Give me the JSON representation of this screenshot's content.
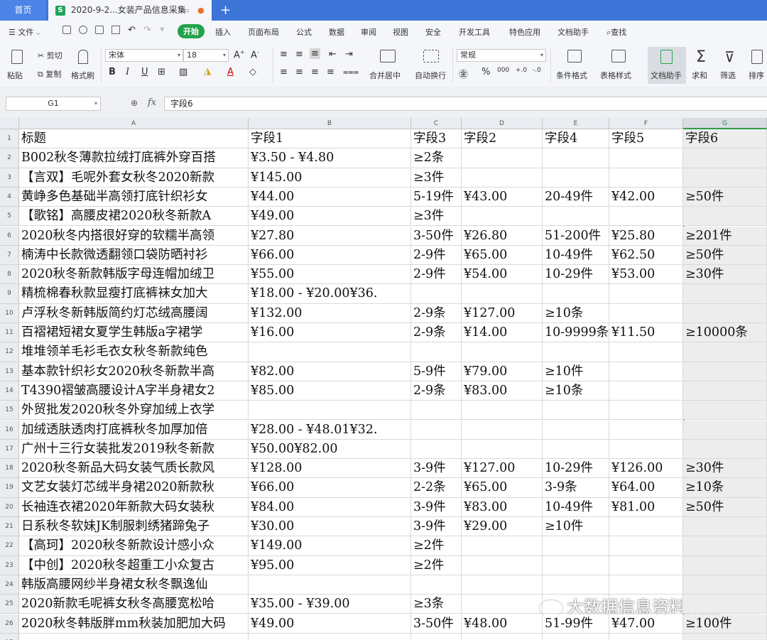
{
  "tabs": {
    "home": "首页",
    "file": "2020-9-2...女装产品信息采集",
    "file_icon": "S",
    "plus": "+"
  },
  "menu": {
    "file": "文件",
    "items": [
      "开始",
      "插入",
      "页面布局",
      "公式",
      "数据",
      "审阅",
      "视图",
      "安全",
      "开发工具",
      "特色应用",
      "文档助手",
      "查找"
    ]
  },
  "ribbon": {
    "paste": "粘贴",
    "cut": "剪切",
    "copy": "复制",
    "format_painter": "格式刷",
    "font_name": "宋体",
    "font_size": "18",
    "merge_center": "合并居中",
    "wrap_text": "自动换行",
    "number_format": "常规",
    "conditional_format": "条件格式",
    "table_style": "表格样式",
    "doc_assistant": "文档助手",
    "sum": "求和",
    "filter": "筛选",
    "sort": "排序"
  },
  "formula_bar": {
    "cell_ref": "G1",
    "fx": "fx",
    "content": "字段6"
  },
  "columns": [
    "A",
    "B",
    "C",
    "D",
    "E",
    "F",
    "G"
  ],
  "selected_column": "G",
  "rows": [
    {
      "n": "1",
      "cells": [
        "标题",
        "字段1",
        "字段3",
        "字段2",
        "字段4",
        "字段5",
        "字段6"
      ]
    },
    {
      "n": "2",
      "cells": [
        "B002秋冬薄款拉绒打底裤外穿百搭",
        "¥3.50  -  ¥4.80",
        "≥2条",
        "",
        "",
        "",
        ""
      ]
    },
    {
      "n": "3",
      "cells": [
        "【言双】毛呢外套女秋冬2020新款",
        "¥145.00",
        "≥3件",
        "",
        "",
        "",
        ""
      ]
    },
    {
      "n": "4",
      "cells": [
        "黄峥多色基础半高领打底针织衫女",
        "¥44.00",
        "5-19件",
        "¥43.00",
        "20-49件",
        "¥42.00",
        "≥50件"
      ]
    },
    {
      "n": "5",
      "cells": [
        "【歌铭】高腰皮裙2020秋冬新款A",
        "¥49.00",
        "≥3件",
        "",
        "",
        "",
        ""
      ]
    },
    {
      "n": "6",
      "cells": [
        "2020秋冬内搭很好穿的软糯半高领",
        "¥27.80",
        "3-50件",
        "¥26.80",
        "51-200件",
        "¥25.80",
        "≥201件"
      ]
    },
    {
      "n": "7",
      "cells": [
        "楠涛中长款微透翻领口袋防晒衬衫",
        "¥66.00",
        "2-9件",
        "¥65.00",
        "10-49件",
        "¥62.50",
        "≥50件"
      ]
    },
    {
      "n": "8",
      "cells": [
        "2020秋冬新款韩版字母连帽加绒卫",
        "¥55.00",
        "2-9件",
        "¥54.00",
        "10-29件",
        "¥53.00",
        "≥30件"
      ]
    },
    {
      "n": "9",
      "cells": [
        "精梳棉春秋款显瘦打底裤袜女加大",
        "¥18.00  -  ¥20.00¥36.",
        "",
        "",
        "",
        "",
        ""
      ]
    },
    {
      "n": "10",
      "cells": [
        "卢浮秋冬新韩版简约灯芯绒高腰阔",
        "¥132.00",
        "2-9条",
        "¥127.00",
        "≥10条",
        "",
        ""
      ]
    },
    {
      "n": "11",
      "cells": [
        "百褶裙短裙女夏学生韩版a字裙学",
        "¥16.00",
        "2-9条",
        "¥14.00",
        "10-9999条",
        "¥11.50",
        "≥10000条"
      ]
    },
    {
      "n": "12",
      "cells": [
        "堆堆领羊毛衫毛衣女秋冬新款纯色",
        "",
        "",
        "",
        "",
        "",
        ""
      ]
    },
    {
      "n": "13",
      "cells": [
        "基本款针织衫女2020秋冬新款半高",
        "¥82.00",
        "5-9件",
        "¥79.00",
        "≥10件",
        "",
        ""
      ]
    },
    {
      "n": "14",
      "cells": [
        "T4390褶皱高腰设计A字半身裙女2",
        "¥85.00",
        "2-9条",
        "¥83.00",
        "≥10条",
        "",
        ""
      ]
    },
    {
      "n": "15",
      "cells": [
        "外贸批发2020秋冬外穿加绒上衣学",
        "",
        "",
        "",
        "",
        "",
        ""
      ]
    },
    {
      "n": "16",
      "cells": [
        "加绒透肤透肉打底裤秋冬加厚加倍",
        "¥28.00  -  ¥48.01¥32.",
        "",
        "",
        "",
        "",
        ""
      ]
    },
    {
      "n": "17",
      "cells": [
        "广州十三行女装批发2019秋冬新款",
        "¥50.00¥82.00",
        "",
        "",
        "",
        "",
        ""
      ]
    },
    {
      "n": "18",
      "cells": [
        "2020秋冬新品大码女装气质长款风",
        "¥128.00",
        "3-9件",
        "¥127.00",
        "10-29件",
        "¥126.00",
        "≥30件"
      ]
    },
    {
      "n": "19",
      "cells": [
        "文艺女装灯芯绒半身裙2020新款秋",
        "¥66.00",
        "2-2条",
        "¥65.00",
        "3-9条",
        "¥64.00",
        "≥10条"
      ]
    },
    {
      "n": "20",
      "cells": [
        "长袖连衣裙2020年新款大码女装秋",
        "¥84.00",
        "3-9件",
        "¥83.00",
        "10-49件",
        "¥81.00",
        "≥50件"
      ]
    },
    {
      "n": "21",
      "cells": [
        "日系秋冬软妹JK制服刺绣猪蹄兔子",
        "¥30.00",
        "3-9件",
        "¥29.00",
        "≥10件",
        "",
        ""
      ]
    },
    {
      "n": "22",
      "cells": [
        "【高珂】2020秋冬新款设计感小众",
        "¥149.00",
        "≥2件",
        "",
        "",
        "",
        ""
      ]
    },
    {
      "n": "23",
      "cells": [
        "【中创】2020秋冬超重工小众复古",
        "¥95.00",
        "≥2件",
        "",
        "",
        "",
        ""
      ]
    },
    {
      "n": "24",
      "cells": [
        "韩版高腰网纱半身裙女秋冬飘逸仙",
        "",
        "",
        "",
        "",
        "",
        ""
      ]
    },
    {
      "n": "25",
      "cells": [
        "2020新款毛呢裤女秋冬高腰宽松哈",
        "¥35.00  -  ¥39.00",
        "≥3条",
        "",
        "",
        "",
        ""
      ]
    },
    {
      "n": "26",
      "cells": [
        "2020秋冬韩版胖mm秋装加肥加大码",
        "¥49.00",
        "3-50件",
        "¥48.00",
        "51-99件",
        "¥47.00",
        "≥100件"
      ]
    },
    {
      "n": "27",
      "cells": [
        "",
        "",
        "",
        "",
        "",
        "",
        ""
      ]
    }
  ],
  "watermark": "大数据信息资料采集"
}
